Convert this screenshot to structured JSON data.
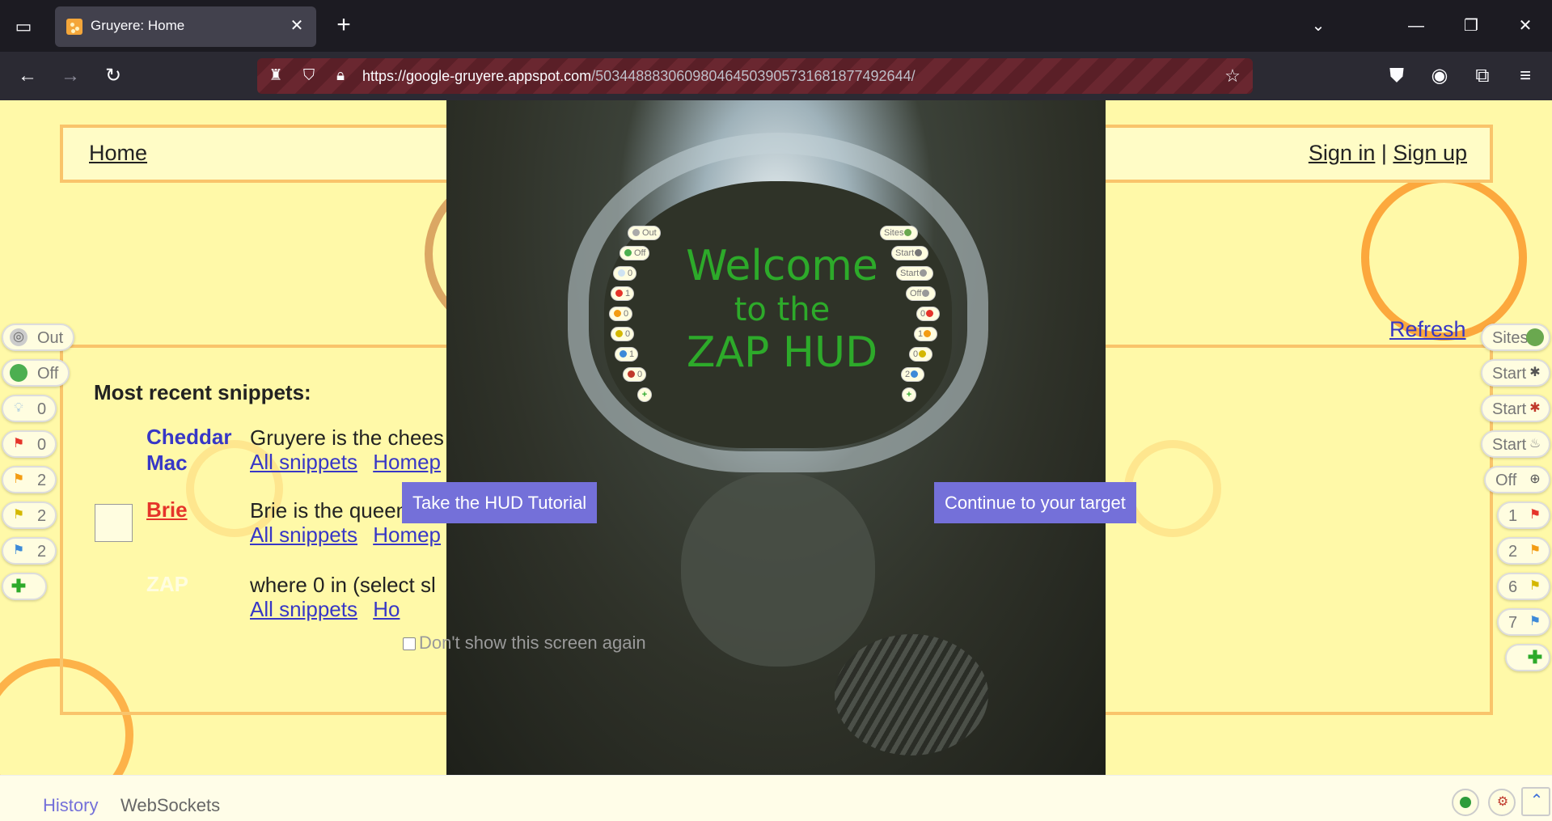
{
  "browser": {
    "tab_title": "Gruyere: Home",
    "url_host": "https://google-gruyere.appspot.com",
    "url_path": "/503448883060980464503905731681877492644/"
  },
  "page": {
    "home_link": "Home",
    "sign_in": "Sign in",
    "separator": "|",
    "sign_up": "Sign up",
    "refresh": "Refresh",
    "heading": "Most recent snippets:",
    "snippets": [
      {
        "author_line1": "Cheddar",
        "author_line2": "Mac",
        "author_color": "#3737c6",
        "text": "Gruyere is the chees",
        "link_all": "All snippets",
        "link_home": "Homep"
      },
      {
        "author_line1": "Brie",
        "author_line2": "",
        "author_color": "#e5342a",
        "text": "Brie is the queen of",
        "link_all": "All snippets",
        "link_home": "Homep"
      },
      {
        "author_line1": "ZAP",
        "author_line2": "",
        "author_color": "#fffde0",
        "text": "where 0 in (select sl",
        "link_all": "All snippets",
        "link_home": "Ho"
      }
    ]
  },
  "hud_left": [
    {
      "label": "Out",
      "icon": "target-icon"
    },
    {
      "label": "Off",
      "icon": "green-dot-icon"
    },
    {
      "label": "0",
      "icon": "lightbulb-icon"
    },
    {
      "label": "0",
      "icon": "red-flag-icon"
    },
    {
      "label": "2",
      "icon": "orange-flag-icon"
    },
    {
      "label": "2",
      "icon": "yellow-flag-icon"
    },
    {
      "label": "2",
      "icon": "blue-flag-icon"
    },
    {
      "label": "",
      "icon": "plus-icon"
    }
  ],
  "hud_right": [
    {
      "label": "Sites",
      "icon": "globe-icon"
    },
    {
      "label": "Start",
      "icon": "spider-icon"
    },
    {
      "label": "Start",
      "icon": "ajax-spider-icon"
    },
    {
      "label": "Start",
      "icon": "flame-icon"
    },
    {
      "label": "Off",
      "icon": "crosshair-icon"
    },
    {
      "label": "1",
      "icon": "red-flag-icon"
    },
    {
      "label": "2",
      "icon": "orange-flag-icon"
    },
    {
      "label": "6",
      "icon": "yellow-flag-icon"
    },
    {
      "label": "7",
      "icon": "blue-flag-icon"
    },
    {
      "label": "",
      "icon": "plus-icon"
    }
  ],
  "overlay": {
    "welcome_line1": "Welcome",
    "welcome_line2": "to the",
    "welcome_line3": "ZAP HUD",
    "mini_left": [
      "Out",
      "Off",
      "0",
      "1",
      "0",
      "0",
      "1",
      "0"
    ],
    "mini_right": [
      "Sites",
      "Start",
      "Start",
      "Off",
      "0",
      "1",
      "0",
      "2"
    ],
    "tutorial_button": "Take the HUD Tutorial",
    "continue_button": "Continue to your target",
    "dont_show": "Don't show this screen again",
    "button_color": "#7470d9",
    "welcome_color": "#2daa2a"
  },
  "bottom": {
    "history_tab": "History",
    "websockets_tab": "WebSockets"
  }
}
